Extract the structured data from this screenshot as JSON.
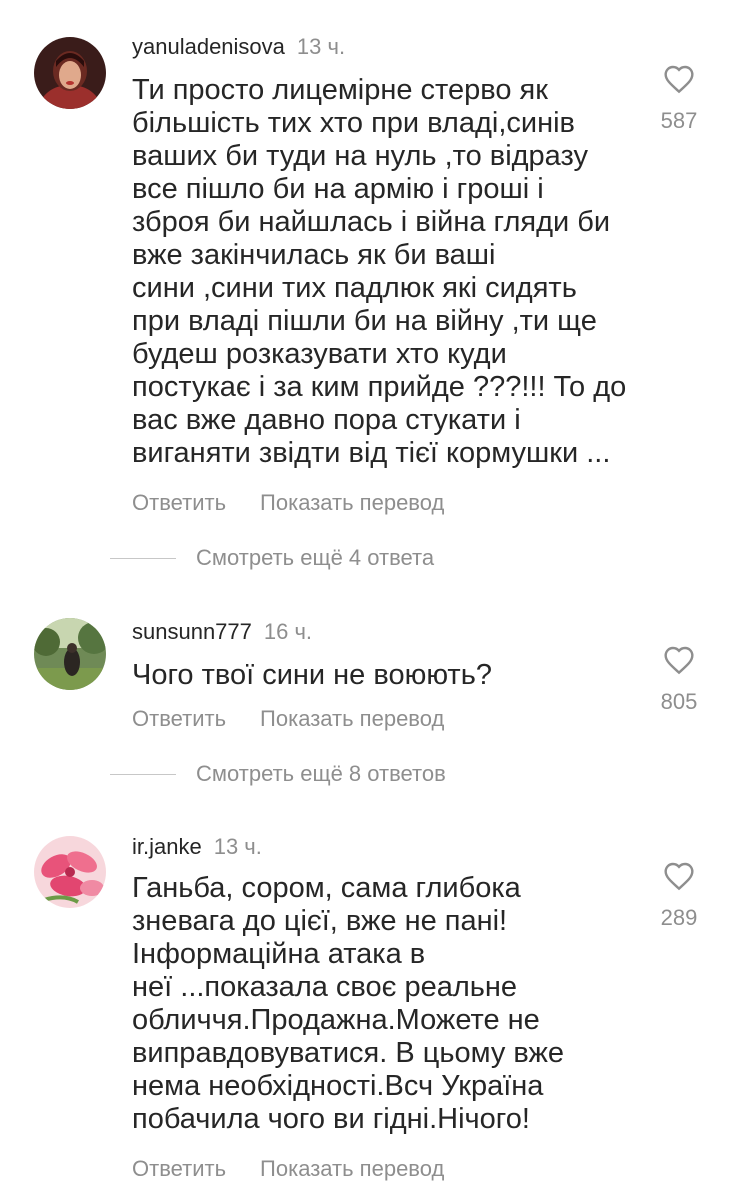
{
  "comments": [
    {
      "username": "yanuladenisova",
      "time": "13 ч.",
      "text_lines": [
        "Ти просто лицемірне стерво як",
        "більшість тих хто при владі,синів",
        "ваших би туди на нуль ,то відразу",
        "все пішло би на армію і гроші і",
        "зброя би найшлась і війна гляди би",
        "вже закінчилась як би ваші",
        "сини ,сини тих падлюк які сидять",
        "при владі пішли би на війну ,ти ще",
        "будеш розказувати хто куди",
        "постукає і за ким прийде ???!!! То до",
        "вас вже давно пора стукати і",
        "виганяти звідти від тієї кормушки ..."
      ],
      "likes": "587",
      "reply": "Ответить",
      "translate": "Показать перевод",
      "more_replies": "Смотреть ещё 4 ответа"
    },
    {
      "username": "sunsunn777",
      "time": "16 ч.",
      "text_lines": [
        "Чого твої сини не воюють?"
      ],
      "likes": "805",
      "reply": "Ответить",
      "translate": "Показать перевод",
      "more_replies": "Смотреть ещё 8 ответов"
    },
    {
      "username": "ir.janke",
      "time": "13 ч.",
      "text_lines": [
        "Ганьба, сором, сама глибока",
        "зневага до цієї, вже не пані!",
        "Інформаційна атака в",
        "неї ...показала своє реальне",
        "обличчя.Продажна.Можете не",
        "виправдовуватися. В цьому вже",
        "нема необхідності.Всч Україна",
        "побачила чого ви гідні.Нічого!"
      ],
      "likes": "289",
      "reply": "Ответить",
      "translate": "Показать перевод"
    }
  ],
  "colors": {
    "text": "#262626",
    "secondary": "#8e8e8e",
    "divider": "#c7c7c7"
  },
  "icons": {
    "like": "heart-outline-icon"
  }
}
